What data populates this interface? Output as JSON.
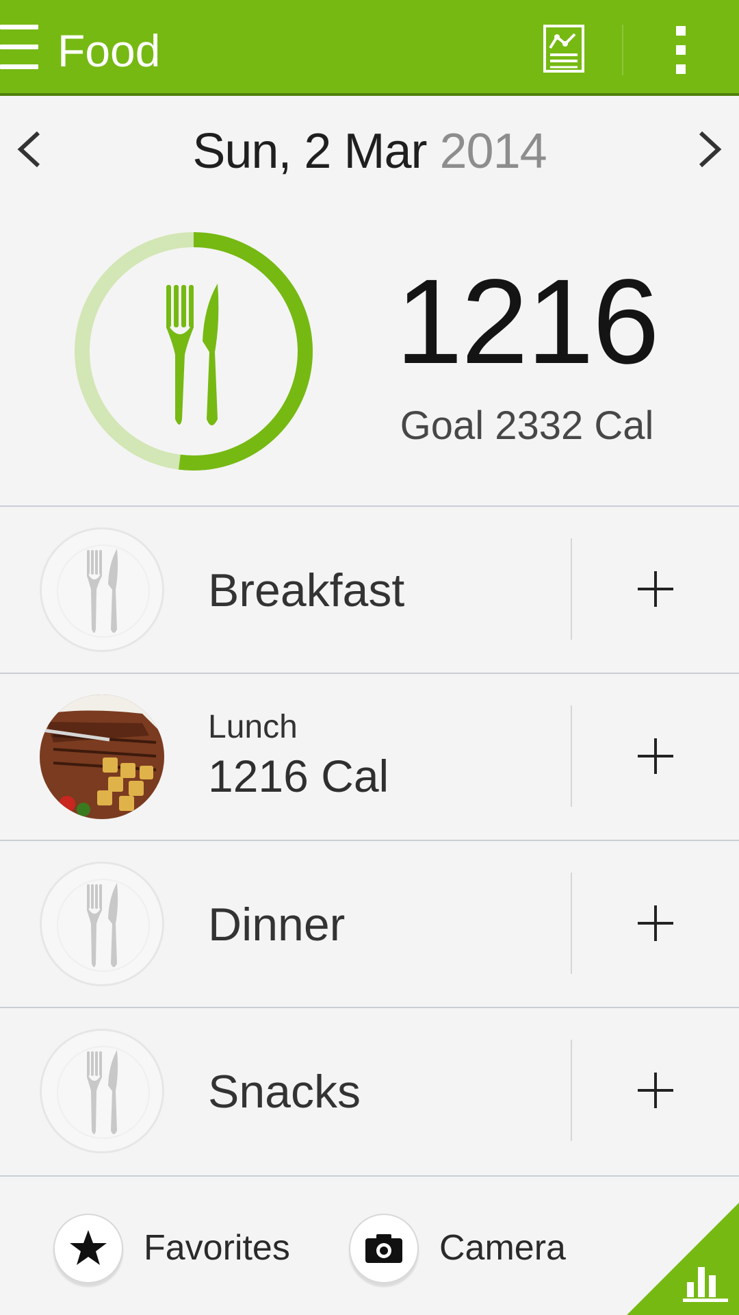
{
  "header": {
    "title": "Food",
    "icons": {
      "menu": "menu-icon",
      "report": "chart-report-icon",
      "overflow": "more-options-icon"
    }
  },
  "date": {
    "main": "Sun, 2 Mar",
    "year": "2014",
    "prev_icon": "chevron-left-icon",
    "next_icon": "chevron-right-icon"
  },
  "summary": {
    "calories": "1216",
    "goal_text": "Goal 2332 Cal",
    "progress_fraction": 0.52,
    "icon": "fork-knife-icon"
  },
  "meals": [
    {
      "label": "Breakfast"
    },
    {
      "label": "Lunch",
      "calories_text": "1216 Cal",
      "thumbnail": "steak-photo"
    },
    {
      "label": "Dinner"
    },
    {
      "label": "Snacks"
    }
  ],
  "bottom": {
    "favorites_label": "Favorites",
    "camera_label": "Camera",
    "corner_icon": "bar-chart-icon"
  },
  "colors": {
    "accent": "#76b913",
    "accent_light": "#d3e6b5",
    "background": "#f4f4f4"
  }
}
